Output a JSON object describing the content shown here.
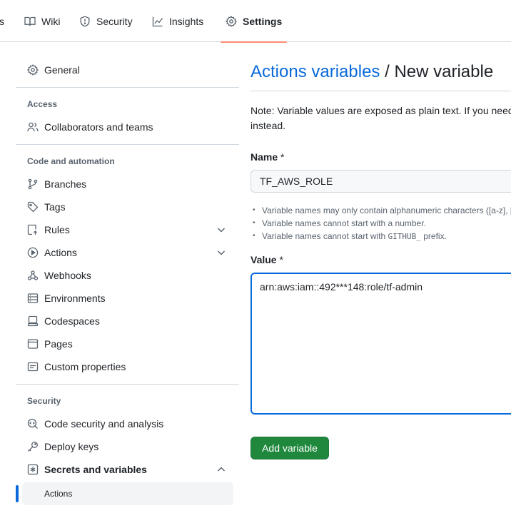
{
  "top_nav": {
    "partial_tab": "s",
    "tabs": [
      {
        "label": "Wiki"
      },
      {
        "label": "Security"
      },
      {
        "label": "Insights"
      },
      {
        "label": "Settings"
      }
    ],
    "active_underline_color": "#fd8c73"
  },
  "sidebar": {
    "general": "General",
    "access_heading": "Access",
    "collaborators": "Collaborators and teams",
    "code_heading": "Code and automation",
    "branches": "Branches",
    "tags": "Tags",
    "rules": "Rules",
    "actions": "Actions",
    "webhooks": "Webhooks",
    "environments": "Environments",
    "codespaces": "Codespaces",
    "pages": "Pages",
    "custom_properties": "Custom properties",
    "security_heading": "Security",
    "code_security": "Code security and analysis",
    "deploy_keys": "Deploy keys",
    "secrets_variables": "Secrets and variables",
    "sub_actions": "Actions"
  },
  "main": {
    "breadcrumb_link": "Actions variables",
    "breadcrumb_sep": " / ",
    "breadcrumb_current": "New variable",
    "note_line1": "Note: Variable values are exposed as plain text. If you need",
    "note_line2": "instead.",
    "name_label": "Name",
    "required_mark": "*",
    "name_value": "TF_AWS_ROLE",
    "hint1": "Variable names may only contain alphanumeric characters ([a-z], [",
    "hint2": "Variable names cannot start with a number.",
    "hint3_prefix": "Variable names cannot start with ",
    "hint3_code": "GITHUB_",
    "hint3_suffix": " prefix.",
    "value_label": "Value",
    "value_text": "arn:aws:iam::492***148:role/tf-admin",
    "add_button": "Add variable"
  },
  "colors": {
    "link": "#0969da",
    "primary_button": "#1f883d",
    "focus_border": "#0969da"
  }
}
